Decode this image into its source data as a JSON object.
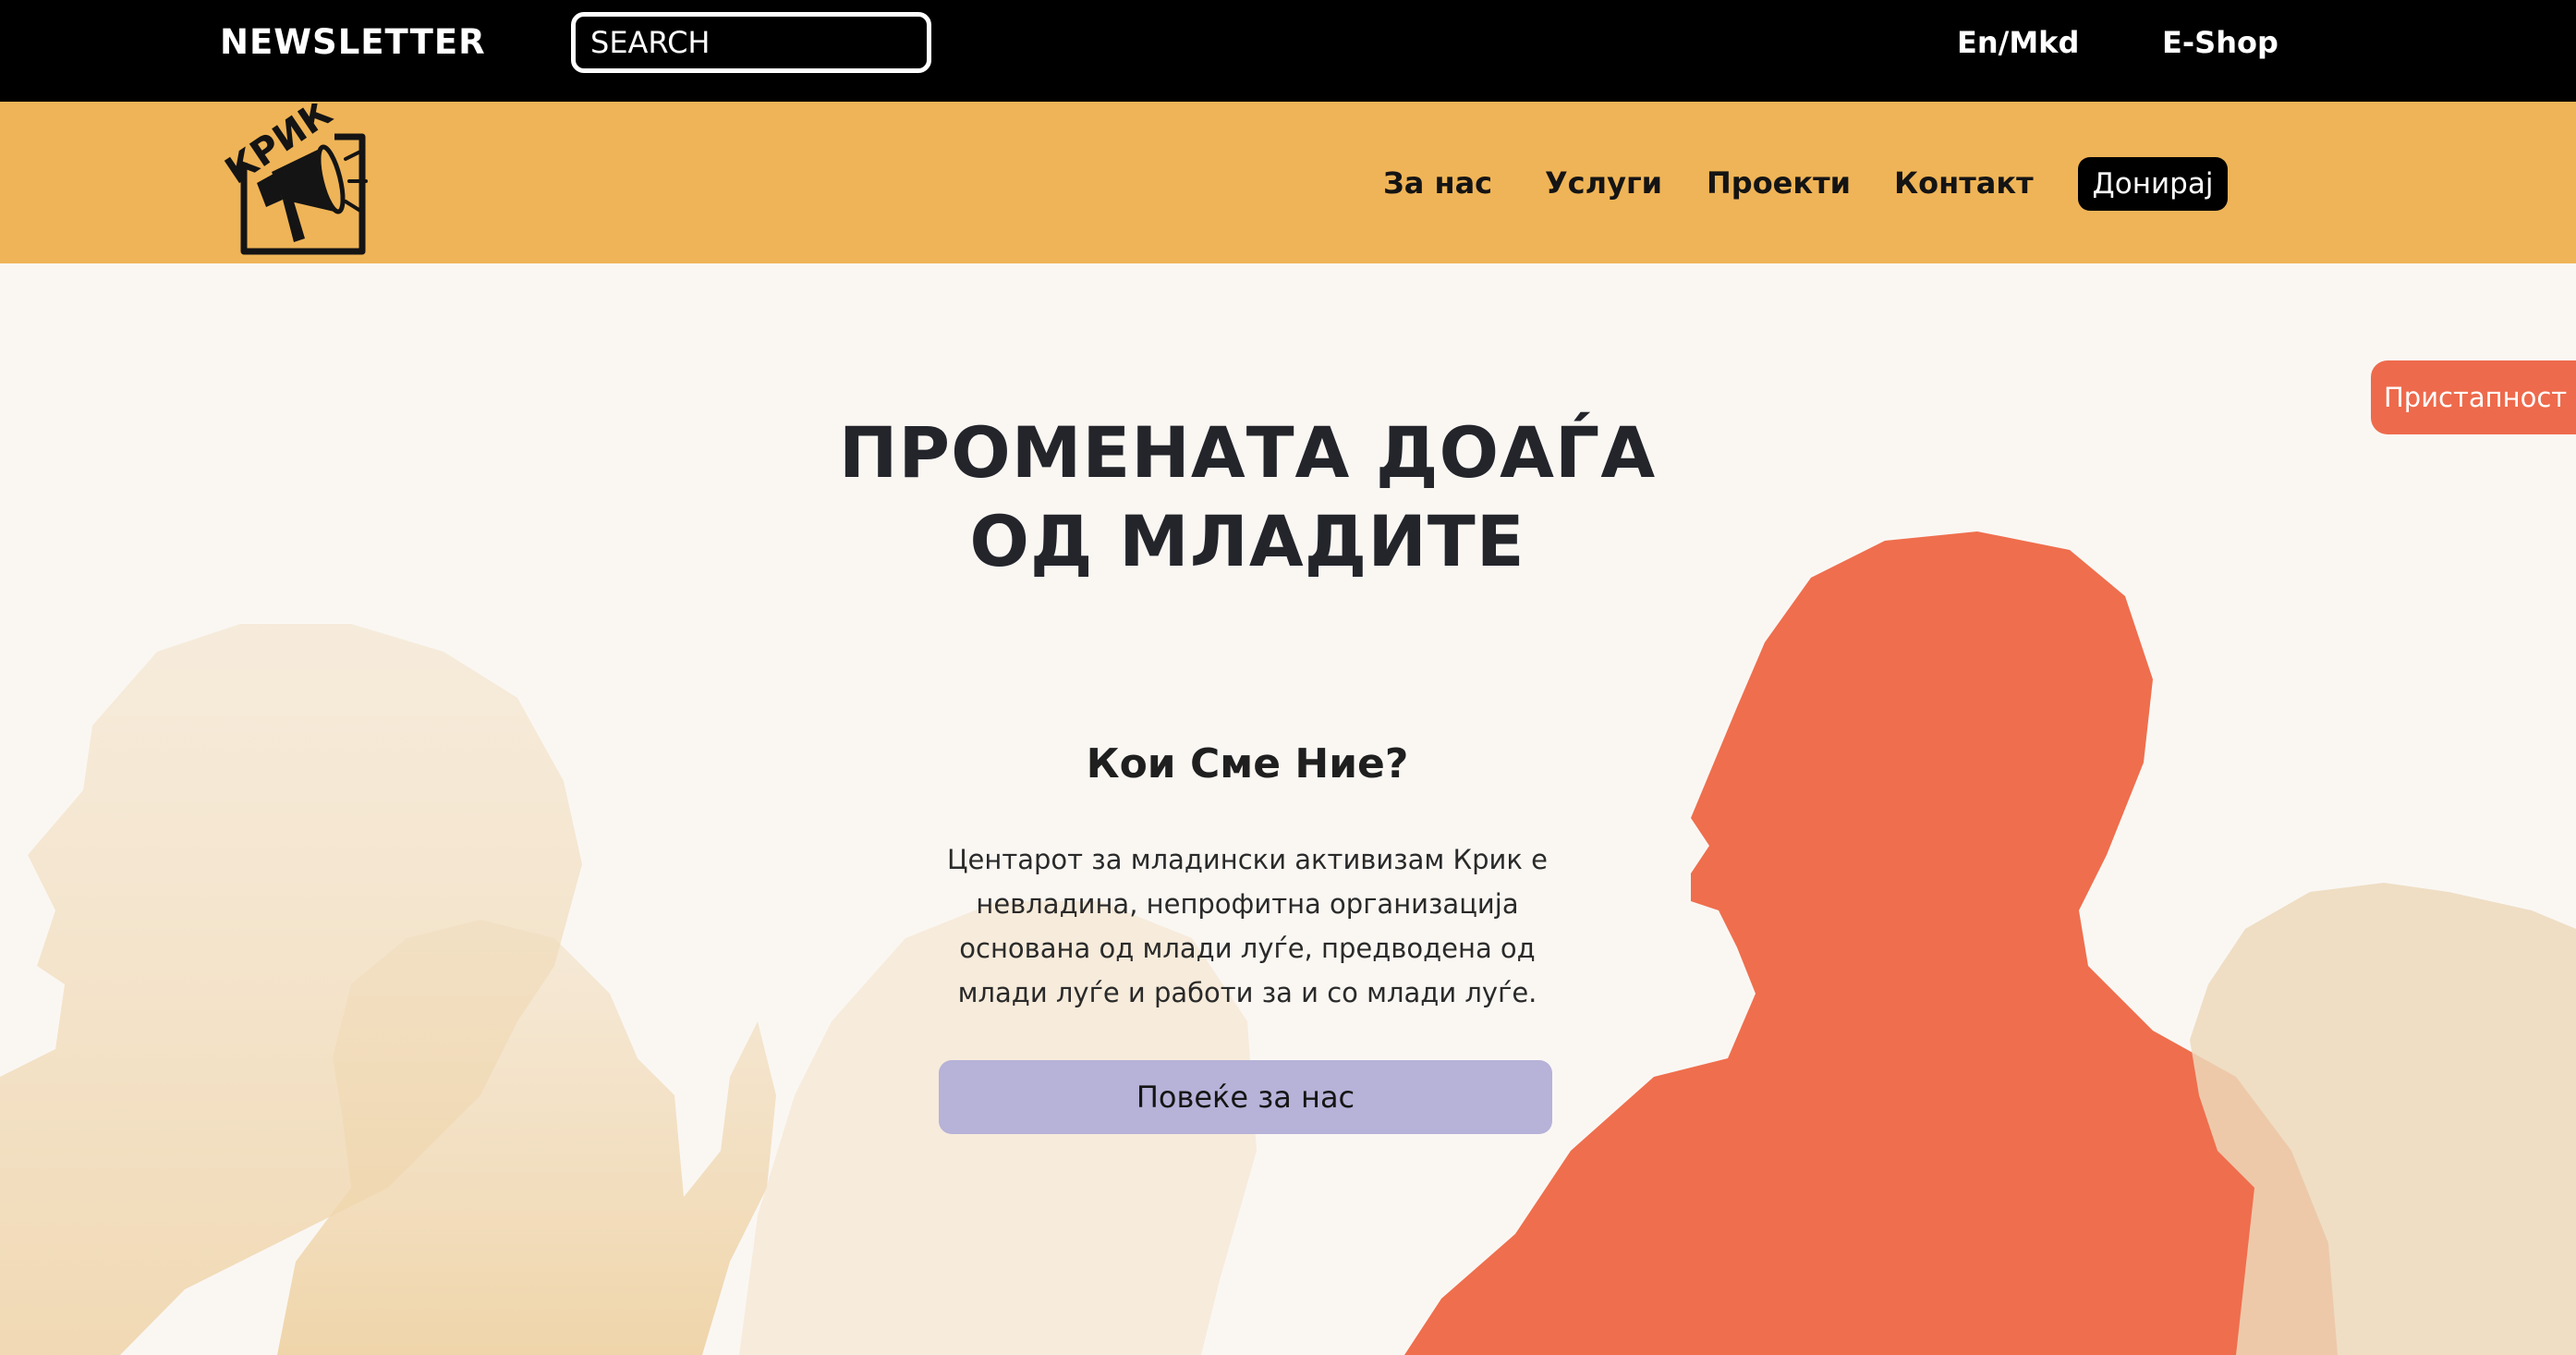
{
  "topbar": {
    "newsletter": "NEWSLETTER",
    "search_placeholder": "SEARCH",
    "language": "En/Mkd",
    "eshop": "E-Shop"
  },
  "logo": {
    "text": "КРИК"
  },
  "nav": {
    "items": [
      {
        "label": "За нас"
      },
      {
        "label": "Услуги"
      },
      {
        "label": "Проекти"
      },
      {
        "label": "Контакт"
      }
    ],
    "donate": "Донирај"
  },
  "hero": {
    "title_line1": "ПРОМЕНАТА ДОАЃА",
    "title_line2": "ОД МЛАДИТЕ",
    "who_title": "Кои Сме Ние?",
    "who_text": "Центарот за младински активизам Крик е невладина, непрофитна организација основана од млади луѓе, предводена од млади луѓе и работи за и со млади луѓе.",
    "more_button": "Повеќе за нас"
  },
  "accessibility": {
    "label": "Пристапност"
  },
  "colors": {
    "topbar": "#000000",
    "navbar": "#efb457",
    "hero_bg": "#faf7f3",
    "silhouette_pale": "#f1d9b4",
    "silhouette_accent": "#ef6e4d",
    "button": "#b6b2d8",
    "accessibility": "#ee6a4c"
  }
}
